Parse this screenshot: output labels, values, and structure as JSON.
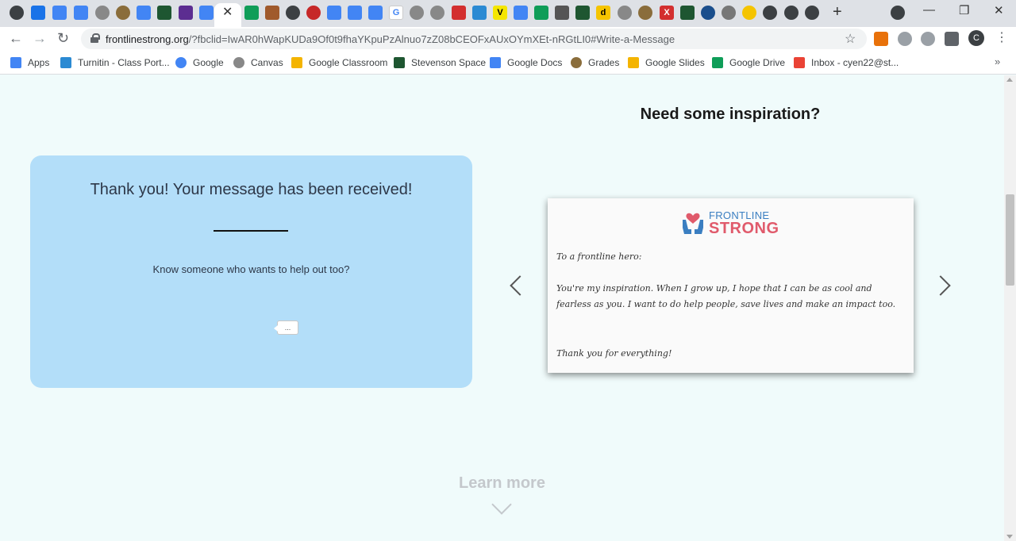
{
  "browser": {
    "url_host": "frontlinestrong.org",
    "url_path": "/?fbclid=IwAR0hWapKUDa9Of0t9fhaYKpuPzAlnuo7zZ08bCEOFxAUxOYmXEt-nRGtLI0#Write-a-Message",
    "profile_initial": "C",
    "new_tab_glyph": "+",
    "close_tab_glyph": "✕",
    "window_minimize": "—",
    "window_restore": "❐",
    "window_close": "✕",
    "back_glyph": "←",
    "forward_glyph": "→",
    "reload_glyph": "↻",
    "star_glyph": "☆",
    "menu_glyph": "⋮",
    "bookmarks_more_glyph": "»"
  },
  "bookmarks": [
    {
      "label": "Apps",
      "icon": "apps-grid-icon",
      "color": "#4285f4"
    },
    {
      "label": "Turnitin - Class Port...",
      "icon": "turnitin-icon",
      "color": "#2b8ad3"
    },
    {
      "label": "Google",
      "icon": "google-icon",
      "color": "#4285f4"
    },
    {
      "label": "Canvas",
      "icon": "canvas-icon",
      "color": "#666666"
    },
    {
      "label": "Google Classroom",
      "icon": "classroom-icon",
      "color": "#f4b400"
    },
    {
      "label": "Stevenson Space",
      "icon": "stevenson-icon",
      "color": "#1e5631"
    },
    {
      "label": "Google Docs",
      "icon": "docs-icon",
      "color": "#4285f4"
    },
    {
      "label": "Grades",
      "icon": "grades-icon",
      "color": "#8a6d3b"
    },
    {
      "label": "Google Slides",
      "icon": "slides-icon",
      "color": "#f4b400"
    },
    {
      "label": "Google Drive",
      "icon": "drive-icon",
      "color": "#0f9d58"
    },
    {
      "label": "Inbox - cyen22@st...",
      "icon": "gmail-icon",
      "color": "#ea4335"
    }
  ],
  "message_card": {
    "title": "Thank you! Your message has been received!",
    "subtitle": "Know someone who wants to help out too?",
    "share_label": "..."
  },
  "inspiration": {
    "heading": "Need some inspiration?",
    "logo_line1": "FRONTLINE",
    "logo_line2": "STRONG",
    "greeting": "To a frontline hero:",
    "body": "You're my inspiration. When I grow up, I hope that I can be as cool and fearless as you. I want to do help people, save lives and make an impact too.",
    "closing": "Thank you for everything!"
  },
  "learn_more": "Learn more",
  "colors": {
    "page_bg": "#f0fbfb",
    "card_bg": "#b3def9",
    "logo_blue": "#3a7ec1",
    "logo_red": "#e05a6b"
  }
}
